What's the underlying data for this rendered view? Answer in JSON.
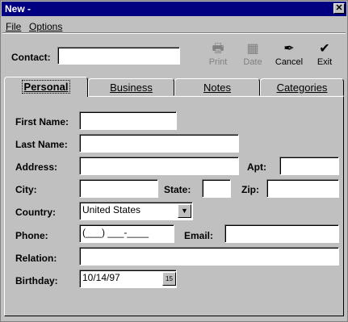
{
  "window": {
    "title": "New -"
  },
  "menu": {
    "file": "File",
    "options": "Options"
  },
  "toolbar": {
    "contact_label": "Contact:",
    "contact_value": "",
    "print_label": "Print",
    "date_label": "Date",
    "cancel_label": "Cancel",
    "exit_label": "Exit",
    "icons": {
      "print": "printer-icon",
      "date": "calendar-icon",
      "cancel": "cancel-quill-icon",
      "exit": "checkmark-icon"
    }
  },
  "tabs": [
    {
      "label": "Personal",
      "active": true
    },
    {
      "label": "Business",
      "active": false
    },
    {
      "label": "Notes",
      "active": false
    },
    {
      "label": "Categories",
      "active": false
    }
  ],
  "form": {
    "first_name_label": "First Name:",
    "last_name_label": "Last Name:",
    "address_label": "Address:",
    "apt_label": "Apt:",
    "city_label": "City:",
    "state_label": "State:",
    "zip_label": "Zip:",
    "country_label": "Country:",
    "country_value": "United States",
    "phone_label": "Phone:",
    "phone_value": "(___) ___-____",
    "email_label": "Email:",
    "relation_label": "Relation:",
    "birthday_label": "Birthday:",
    "birthday_value": "10/14/97",
    "calendar_button_text": "15"
  },
  "colors": {
    "titlebar": "#000080",
    "face": "#c0c0c0"
  }
}
